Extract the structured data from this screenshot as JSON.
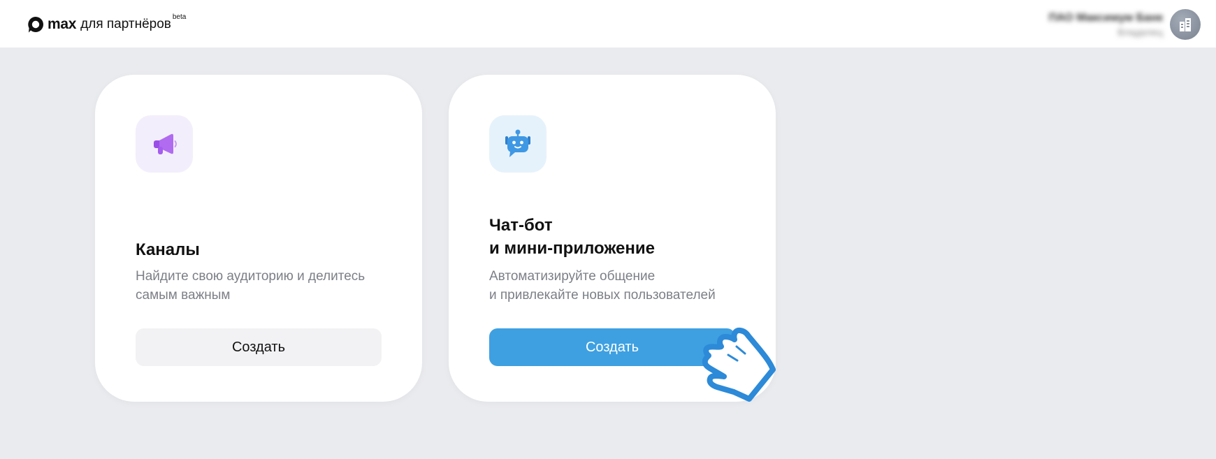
{
  "header": {
    "logo_text": "max",
    "logo_subtitle": "для партнёров",
    "logo_badge": "beta",
    "account_name": "ПАО Максимум Банк",
    "account_role": "Владелец",
    "avatar_icon": "building-icon"
  },
  "cards": [
    {
      "icon": "megaphone-icon",
      "title": "Каналы",
      "description_line1": "Найдите свою аудиторию и делитесь",
      "description_line2": "самым важным",
      "button_label": "Создать"
    },
    {
      "icon": "robot-chat-icon",
      "title_line1": "Чат-бот",
      "title_line2": "и мини-приложение",
      "description_line1": "Автоматизируйте общение",
      "description_line2": "и привлекайте новых пользователей",
      "button_label": "Создать"
    }
  ],
  "overlay": {
    "icon": "pointing-hand-icon"
  },
  "colors": {
    "page_background": "#eaebee",
    "primary_button": "#3ea0e1",
    "secondary_button": "#f2f2f4",
    "channel_icon_accent": "#b06bf0",
    "bot_icon_accent": "#3f98e4"
  }
}
